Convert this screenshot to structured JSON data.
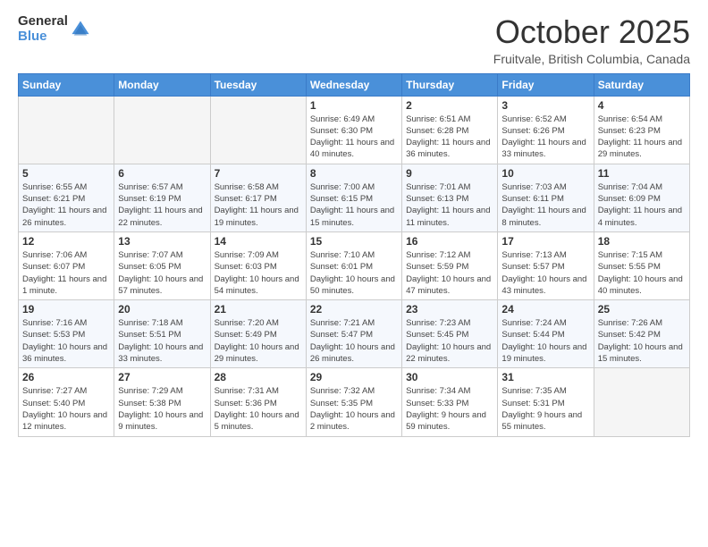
{
  "header": {
    "logo_general": "General",
    "logo_blue": "Blue",
    "month_title": "October 2025",
    "location": "Fruitvale, British Columbia, Canada"
  },
  "days_of_week": [
    "Sunday",
    "Monday",
    "Tuesday",
    "Wednesday",
    "Thursday",
    "Friday",
    "Saturday"
  ],
  "weeks": [
    [
      {
        "day": "",
        "sunrise": "",
        "sunset": "",
        "daylight": ""
      },
      {
        "day": "",
        "sunrise": "",
        "sunset": "",
        "daylight": ""
      },
      {
        "day": "",
        "sunrise": "",
        "sunset": "",
        "daylight": ""
      },
      {
        "day": "1",
        "sunrise": "Sunrise: 6:49 AM",
        "sunset": "Sunset: 6:30 PM",
        "daylight": "Daylight: 11 hours and 40 minutes."
      },
      {
        "day": "2",
        "sunrise": "Sunrise: 6:51 AM",
        "sunset": "Sunset: 6:28 PM",
        "daylight": "Daylight: 11 hours and 36 minutes."
      },
      {
        "day": "3",
        "sunrise": "Sunrise: 6:52 AM",
        "sunset": "Sunset: 6:26 PM",
        "daylight": "Daylight: 11 hours and 33 minutes."
      },
      {
        "day": "4",
        "sunrise": "Sunrise: 6:54 AM",
        "sunset": "Sunset: 6:23 PM",
        "daylight": "Daylight: 11 hours and 29 minutes."
      }
    ],
    [
      {
        "day": "5",
        "sunrise": "Sunrise: 6:55 AM",
        "sunset": "Sunset: 6:21 PM",
        "daylight": "Daylight: 11 hours and 26 minutes."
      },
      {
        "day": "6",
        "sunrise": "Sunrise: 6:57 AM",
        "sunset": "Sunset: 6:19 PM",
        "daylight": "Daylight: 11 hours and 22 minutes."
      },
      {
        "day": "7",
        "sunrise": "Sunrise: 6:58 AM",
        "sunset": "Sunset: 6:17 PM",
        "daylight": "Daylight: 11 hours and 19 minutes."
      },
      {
        "day": "8",
        "sunrise": "Sunrise: 7:00 AM",
        "sunset": "Sunset: 6:15 PM",
        "daylight": "Daylight: 11 hours and 15 minutes."
      },
      {
        "day": "9",
        "sunrise": "Sunrise: 7:01 AM",
        "sunset": "Sunset: 6:13 PM",
        "daylight": "Daylight: 11 hours and 11 minutes."
      },
      {
        "day": "10",
        "sunrise": "Sunrise: 7:03 AM",
        "sunset": "Sunset: 6:11 PM",
        "daylight": "Daylight: 11 hours and 8 minutes."
      },
      {
        "day": "11",
        "sunrise": "Sunrise: 7:04 AM",
        "sunset": "Sunset: 6:09 PM",
        "daylight": "Daylight: 11 hours and 4 minutes."
      }
    ],
    [
      {
        "day": "12",
        "sunrise": "Sunrise: 7:06 AM",
        "sunset": "Sunset: 6:07 PM",
        "daylight": "Daylight: 11 hours and 1 minute."
      },
      {
        "day": "13",
        "sunrise": "Sunrise: 7:07 AM",
        "sunset": "Sunset: 6:05 PM",
        "daylight": "Daylight: 10 hours and 57 minutes."
      },
      {
        "day": "14",
        "sunrise": "Sunrise: 7:09 AM",
        "sunset": "Sunset: 6:03 PM",
        "daylight": "Daylight: 10 hours and 54 minutes."
      },
      {
        "day": "15",
        "sunrise": "Sunrise: 7:10 AM",
        "sunset": "Sunset: 6:01 PM",
        "daylight": "Daylight: 10 hours and 50 minutes."
      },
      {
        "day": "16",
        "sunrise": "Sunrise: 7:12 AM",
        "sunset": "Sunset: 5:59 PM",
        "daylight": "Daylight: 10 hours and 47 minutes."
      },
      {
        "day": "17",
        "sunrise": "Sunrise: 7:13 AM",
        "sunset": "Sunset: 5:57 PM",
        "daylight": "Daylight: 10 hours and 43 minutes."
      },
      {
        "day": "18",
        "sunrise": "Sunrise: 7:15 AM",
        "sunset": "Sunset: 5:55 PM",
        "daylight": "Daylight: 10 hours and 40 minutes."
      }
    ],
    [
      {
        "day": "19",
        "sunrise": "Sunrise: 7:16 AM",
        "sunset": "Sunset: 5:53 PM",
        "daylight": "Daylight: 10 hours and 36 minutes."
      },
      {
        "day": "20",
        "sunrise": "Sunrise: 7:18 AM",
        "sunset": "Sunset: 5:51 PM",
        "daylight": "Daylight: 10 hours and 33 minutes."
      },
      {
        "day": "21",
        "sunrise": "Sunrise: 7:20 AM",
        "sunset": "Sunset: 5:49 PM",
        "daylight": "Daylight: 10 hours and 29 minutes."
      },
      {
        "day": "22",
        "sunrise": "Sunrise: 7:21 AM",
        "sunset": "Sunset: 5:47 PM",
        "daylight": "Daylight: 10 hours and 26 minutes."
      },
      {
        "day": "23",
        "sunrise": "Sunrise: 7:23 AM",
        "sunset": "Sunset: 5:45 PM",
        "daylight": "Daylight: 10 hours and 22 minutes."
      },
      {
        "day": "24",
        "sunrise": "Sunrise: 7:24 AM",
        "sunset": "Sunset: 5:44 PM",
        "daylight": "Daylight: 10 hours and 19 minutes."
      },
      {
        "day": "25",
        "sunrise": "Sunrise: 7:26 AM",
        "sunset": "Sunset: 5:42 PM",
        "daylight": "Daylight: 10 hours and 15 minutes."
      }
    ],
    [
      {
        "day": "26",
        "sunrise": "Sunrise: 7:27 AM",
        "sunset": "Sunset: 5:40 PM",
        "daylight": "Daylight: 10 hours and 12 minutes."
      },
      {
        "day": "27",
        "sunrise": "Sunrise: 7:29 AM",
        "sunset": "Sunset: 5:38 PM",
        "daylight": "Daylight: 10 hours and 9 minutes."
      },
      {
        "day": "28",
        "sunrise": "Sunrise: 7:31 AM",
        "sunset": "Sunset: 5:36 PM",
        "daylight": "Daylight: 10 hours and 5 minutes."
      },
      {
        "day": "29",
        "sunrise": "Sunrise: 7:32 AM",
        "sunset": "Sunset: 5:35 PM",
        "daylight": "Daylight: 10 hours and 2 minutes."
      },
      {
        "day": "30",
        "sunrise": "Sunrise: 7:34 AM",
        "sunset": "Sunset: 5:33 PM",
        "daylight": "Daylight: 9 hours and 59 minutes."
      },
      {
        "day": "31",
        "sunrise": "Sunrise: 7:35 AM",
        "sunset": "Sunset: 5:31 PM",
        "daylight": "Daylight: 9 hours and 55 minutes."
      },
      {
        "day": "",
        "sunrise": "",
        "sunset": "",
        "daylight": ""
      }
    ]
  ]
}
